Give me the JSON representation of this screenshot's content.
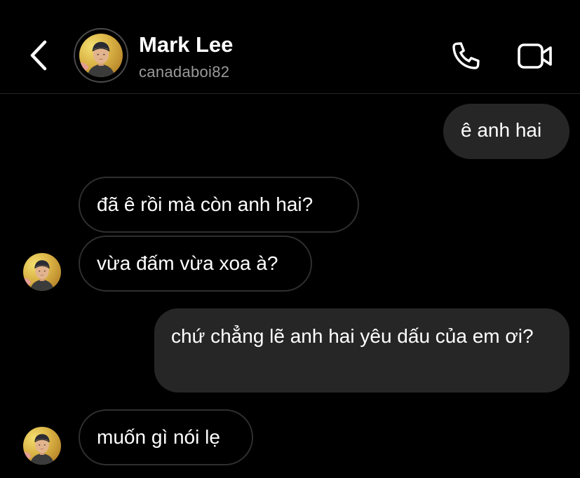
{
  "header": {
    "name": "Mark Lee",
    "username": "canadaboi82",
    "back_icon": "chevron-left-icon",
    "call_icon": "phone-icon",
    "video_icon": "video-camera-icon"
  },
  "messages": [
    {
      "direction": "outgoing",
      "text": "ê anh hai"
    },
    {
      "direction": "incoming",
      "text": "đã ê rồi mà còn anh hai?"
    },
    {
      "direction": "incoming",
      "text": "vừa đấm vừa xoa à?"
    },
    {
      "direction": "outgoing",
      "text": "chứ chẳng lẽ anh hai yêu dấu của em ơi?"
    },
    {
      "direction": "incoming",
      "text": "muốn gì nói lẹ"
    }
  ],
  "colors": {
    "background": "#000000",
    "outgoing_bubble": "#262626",
    "incoming_border": "#2f2f2f",
    "secondary_text": "#9a9a9a"
  }
}
